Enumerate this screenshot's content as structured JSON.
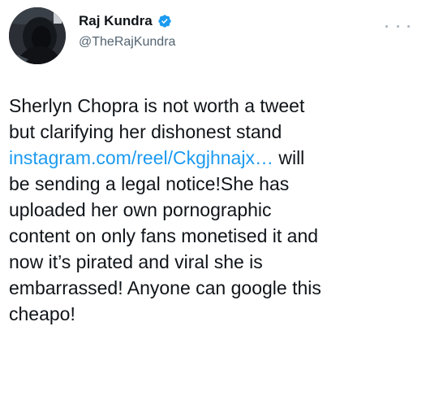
{
  "author": {
    "display_name": "Raj Kundra",
    "handle": "@TheRajKundra",
    "avatar_icon": "profile-photo-hooded-person",
    "verified_icon": "verified-badge-icon",
    "verified_color": "#1d9bf0"
  },
  "menu": {
    "icon": "more-options-icon"
  },
  "tweet": {
    "lines": [
      "Sherlyn Chopra is not worth a tweet",
      "but clarifying her dishonest stand",
      "will",
      "be sending a legal notice!She has",
      "uploaded her own pornographic",
      "content on only fans monetised it and",
      "now it’s pirated and viral she is",
      "embarrassed! Anyone can google this",
      "cheapo!"
    ],
    "link_text": "instagram.com/reel/Ckgjhnajx…",
    "link_color": "#1d9bf0"
  }
}
